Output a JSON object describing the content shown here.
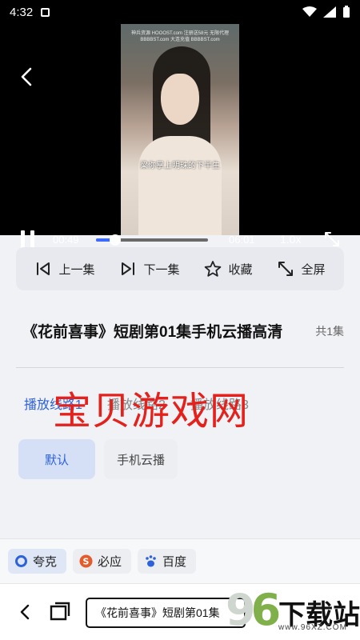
{
  "status_bar": {
    "time": "4:32"
  },
  "player": {
    "watermark_line1": "神兵资源 HOOOST.com 注册送58元 无限代理",
    "watermark_line2": "BBBBST.com 大连充值 BBBBST.com",
    "subtitle": "梁你掌上明珠的下半生",
    "current_time": "00:49",
    "total_time": "06:01",
    "speed": "1.0x",
    "progress": 0.17
  },
  "actions": [
    {
      "id": "prev",
      "label": "上一集"
    },
    {
      "id": "next",
      "label": "下一集"
    },
    {
      "id": "fav",
      "label": "收藏"
    },
    {
      "id": "fullscreen",
      "label": "全屏"
    }
  ],
  "episode": {
    "title": "《花前喜事》短剧第01集手机云播高清",
    "count": "共1集"
  },
  "lines": {
    "tabs": [
      "播放线路1",
      "播放线路2",
      "播放线路3"
    ],
    "active": 0
  },
  "overlay_watermark": "宝贝游戏网",
  "sources": {
    "default": "默认",
    "other": "手机云播"
  },
  "engines": [
    {
      "label": "夸克",
      "color": "#2e62d9"
    },
    {
      "label": "必应",
      "color": "#e35b2b"
    },
    {
      "label": "百度",
      "color": "#2e62d9"
    }
  ],
  "bottom": {
    "address": "《花前喜事》短剧第01集",
    "logo_digits": "96",
    "logo_brand": "下载站",
    "logo_sub": "www.96XZ.COM"
  }
}
